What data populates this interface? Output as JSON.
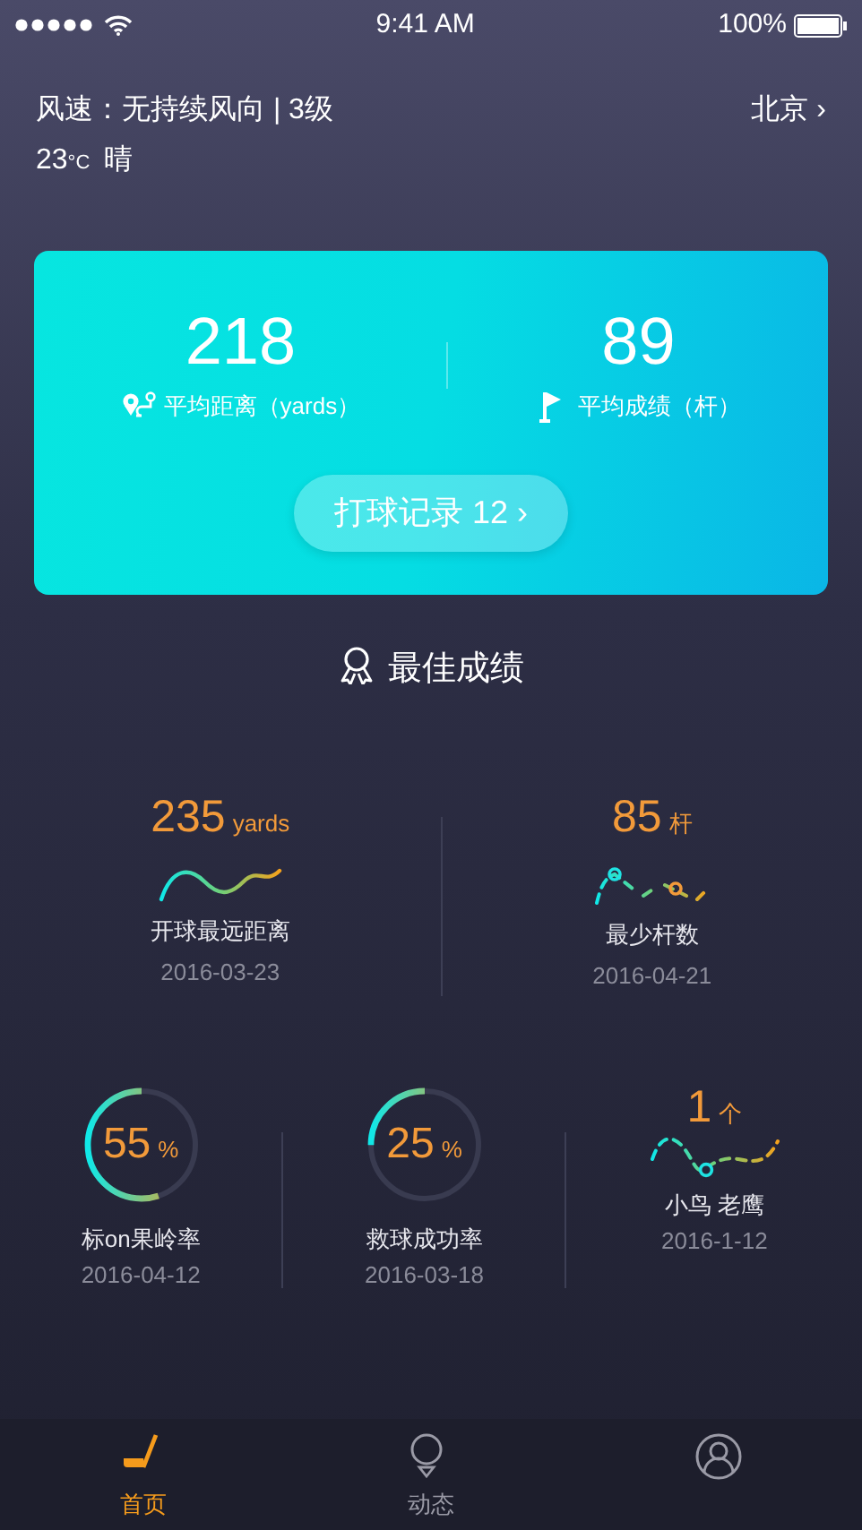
{
  "status_bar": {
    "time": "9:41 AM",
    "battery": "100%"
  },
  "weather": {
    "wind": "风速：无持续风向 | 3级",
    "temperature": "23",
    "unit": "°C",
    "condition": "晴",
    "city": "北京",
    "chevron": "›"
  },
  "summary": {
    "stats": [
      {
        "kind": "distance",
        "value": "218",
        "label": "平均距离（yards）"
      },
      {
        "kind": "flag",
        "value": "89",
        "label": "平均成绩（杆）"
      }
    ],
    "button": {
      "label": "打球记录 12",
      "chevron": "›"
    }
  },
  "best": {
    "title": "最佳成绩",
    "top": [
      {
        "kind": "wave",
        "value": "235",
        "unit": "yards",
        "label": "开球最远距离",
        "date": "2016-03-23"
      },
      {
        "kind": "dots",
        "value": "85",
        "unit": "杆",
        "label": "最少杆数",
        "date": "2016-04-21"
      }
    ],
    "bottom": [
      {
        "kind": "ring",
        "value": "55",
        "unit": "%",
        "level": 0.55,
        "label": "标on果岭率",
        "date": "2016-04-12"
      },
      {
        "kind": "ring",
        "value": "25",
        "unit": "%",
        "level": 0.25,
        "label": "救球成功率",
        "date": "2016-03-18"
      },
      {
        "kind": "dots2",
        "value": "1",
        "unit": "个",
        "label": "小鸟 老鹰",
        "date": "2016-1-12"
      }
    ]
  },
  "tabs": [
    {
      "kind": "club",
      "label": "首页",
      "selected": true
    },
    {
      "kind": "tee",
      "label": "动态",
      "selected": false
    },
    {
      "kind": "profile",
      "selected": false
    }
  ]
}
